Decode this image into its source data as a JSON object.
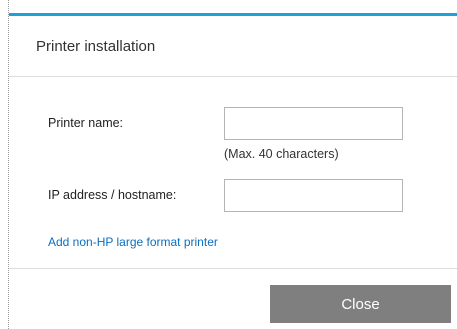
{
  "dialog": {
    "title": "Printer installation",
    "accent_color": "#1ea0d8"
  },
  "form": {
    "printer_name": {
      "label": "Printer name:",
      "value": "",
      "placeholder": "",
      "hint": "(Max. 40 characters)"
    },
    "ip_address": {
      "label": "IP address / hostname:",
      "value": "",
      "placeholder": ""
    },
    "add_link_label": "Add non-HP large format printer"
  },
  "footer": {
    "close_label": "Close",
    "close_color": "#7f7f7f"
  }
}
